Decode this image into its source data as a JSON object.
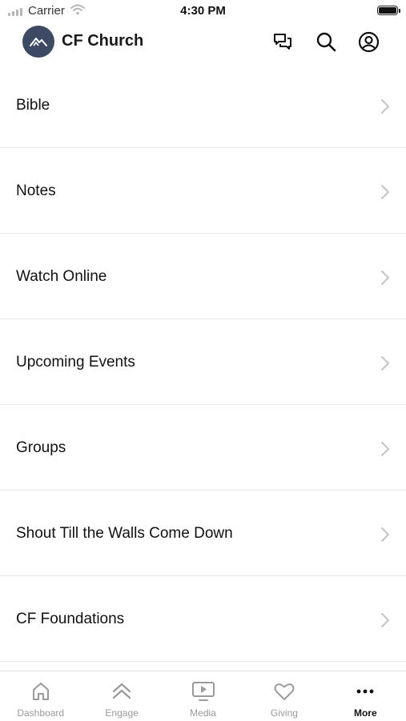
{
  "status_bar": {
    "carrier": "Carrier",
    "time": "4:30 PM"
  },
  "header": {
    "title": "CF Church"
  },
  "menu": {
    "items": [
      {
        "label": "Bible"
      },
      {
        "label": "Notes"
      },
      {
        "label": "Watch Online"
      },
      {
        "label": "Upcoming Events"
      },
      {
        "label": "Groups"
      },
      {
        "label": "Shout Till the Walls Come Down"
      },
      {
        "label": "CF Foundations"
      }
    ]
  },
  "tabs": [
    {
      "label": "Dashboard",
      "icon": "home-icon"
    },
    {
      "label": "Engage",
      "icon": "double-chevron-up-icon"
    },
    {
      "label": "Media",
      "icon": "tv-play-icon"
    },
    {
      "label": "Giving",
      "icon": "heart-icon"
    },
    {
      "label": "More",
      "icon": "more-dots-icon",
      "active": true
    }
  ],
  "colors": {
    "logo_bg": "#3e4a63",
    "inactive_tab": "#9a9a9a",
    "active_tab": "#111111",
    "divider": "#e9e9e9"
  }
}
